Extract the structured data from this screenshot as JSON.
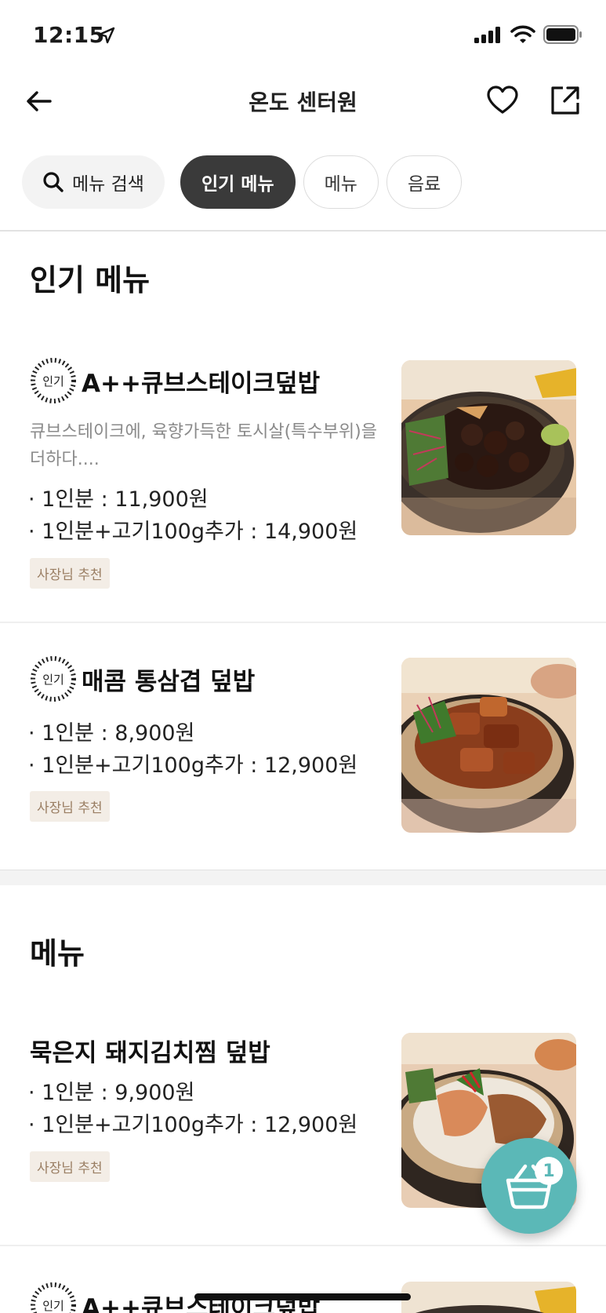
{
  "status_bar": {
    "time": "12:15"
  },
  "header": {
    "title": "온도 센터원"
  },
  "tabs": {
    "search_label": "메뉴 검색",
    "items": [
      {
        "label": "인기 메뉴",
        "active": true
      },
      {
        "label": "메뉴",
        "active": false
      },
      {
        "label": "음료",
        "active": false
      }
    ]
  },
  "popular_section": {
    "title": "인기 메뉴",
    "items": [
      {
        "badge": "인기",
        "name": "A++큐브스테이크덮밥",
        "description": "큐브스테이크에, 육향가득한 토시살(특수부위)을 더하다....",
        "prices": [
          "· 1인분 : 11,900원",
          "· 1인분+고기100g추가 : 14,900원"
        ],
        "tag": "사장님 추천"
      },
      {
        "badge": "인기",
        "name": "매콤 통삼겹 덮밥",
        "prices": [
          "· 1인분 : 8,900원",
          "· 1인분+고기100g추가 : 12,900원"
        ],
        "tag": "사장님 추천"
      }
    ]
  },
  "menu_section": {
    "title": "메뉴",
    "items": [
      {
        "name": "묵은지 돼지김치찜 덮밥",
        "prices": [
          "· 1인분 : 9,900원",
          "· 1인분+고기100g추가 : 12,900원"
        ],
        "tag": "사장님 추천"
      },
      {
        "badge": "인기",
        "name": "A++큐브스테이크덮밥"
      }
    ]
  },
  "cart": {
    "count": "1"
  },
  "colors": {
    "accent": "#5bb8b7",
    "active_chip": "#3a3a3a",
    "tag_bg": "#f3ede6",
    "tag_text": "#9a7e63"
  }
}
